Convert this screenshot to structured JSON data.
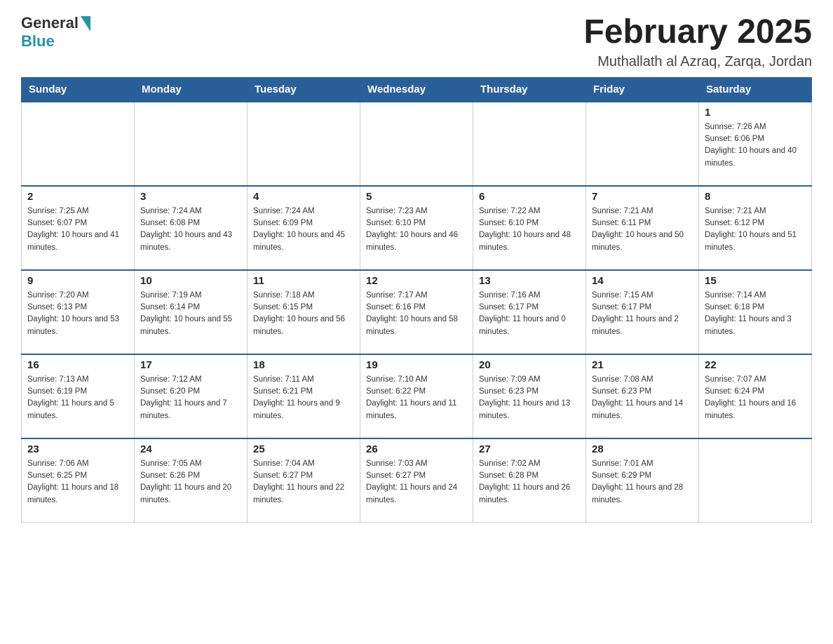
{
  "header": {
    "logo_general": "General",
    "logo_blue": "Blue",
    "month_title": "February 2025",
    "location": "Muthallath al Azraq, Zarqa, Jordan"
  },
  "weekdays": [
    "Sunday",
    "Monday",
    "Tuesday",
    "Wednesday",
    "Thursday",
    "Friday",
    "Saturday"
  ],
  "weeks": [
    [
      {
        "day": "",
        "sunrise": "",
        "sunset": "",
        "daylight": ""
      },
      {
        "day": "",
        "sunrise": "",
        "sunset": "",
        "daylight": ""
      },
      {
        "day": "",
        "sunrise": "",
        "sunset": "",
        "daylight": ""
      },
      {
        "day": "",
        "sunrise": "",
        "sunset": "",
        "daylight": ""
      },
      {
        "day": "",
        "sunrise": "",
        "sunset": "",
        "daylight": ""
      },
      {
        "day": "",
        "sunrise": "",
        "sunset": "",
        "daylight": ""
      },
      {
        "day": "1",
        "sunrise": "Sunrise: 7:26 AM",
        "sunset": "Sunset: 6:06 PM",
        "daylight": "Daylight: 10 hours and 40 minutes."
      }
    ],
    [
      {
        "day": "2",
        "sunrise": "Sunrise: 7:25 AM",
        "sunset": "Sunset: 6:07 PM",
        "daylight": "Daylight: 10 hours and 41 minutes."
      },
      {
        "day": "3",
        "sunrise": "Sunrise: 7:24 AM",
        "sunset": "Sunset: 6:08 PM",
        "daylight": "Daylight: 10 hours and 43 minutes."
      },
      {
        "day": "4",
        "sunrise": "Sunrise: 7:24 AM",
        "sunset": "Sunset: 6:09 PM",
        "daylight": "Daylight: 10 hours and 45 minutes."
      },
      {
        "day": "5",
        "sunrise": "Sunrise: 7:23 AM",
        "sunset": "Sunset: 6:10 PM",
        "daylight": "Daylight: 10 hours and 46 minutes."
      },
      {
        "day": "6",
        "sunrise": "Sunrise: 7:22 AM",
        "sunset": "Sunset: 6:10 PM",
        "daylight": "Daylight: 10 hours and 48 minutes."
      },
      {
        "day": "7",
        "sunrise": "Sunrise: 7:21 AM",
        "sunset": "Sunset: 6:11 PM",
        "daylight": "Daylight: 10 hours and 50 minutes."
      },
      {
        "day": "8",
        "sunrise": "Sunrise: 7:21 AM",
        "sunset": "Sunset: 6:12 PM",
        "daylight": "Daylight: 10 hours and 51 minutes."
      }
    ],
    [
      {
        "day": "9",
        "sunrise": "Sunrise: 7:20 AM",
        "sunset": "Sunset: 6:13 PM",
        "daylight": "Daylight: 10 hours and 53 minutes."
      },
      {
        "day": "10",
        "sunrise": "Sunrise: 7:19 AM",
        "sunset": "Sunset: 6:14 PM",
        "daylight": "Daylight: 10 hours and 55 minutes."
      },
      {
        "day": "11",
        "sunrise": "Sunrise: 7:18 AM",
        "sunset": "Sunset: 6:15 PM",
        "daylight": "Daylight: 10 hours and 56 minutes."
      },
      {
        "day": "12",
        "sunrise": "Sunrise: 7:17 AM",
        "sunset": "Sunset: 6:16 PM",
        "daylight": "Daylight: 10 hours and 58 minutes."
      },
      {
        "day": "13",
        "sunrise": "Sunrise: 7:16 AM",
        "sunset": "Sunset: 6:17 PM",
        "daylight": "Daylight: 11 hours and 0 minutes."
      },
      {
        "day": "14",
        "sunrise": "Sunrise: 7:15 AM",
        "sunset": "Sunset: 6:17 PM",
        "daylight": "Daylight: 11 hours and 2 minutes."
      },
      {
        "day": "15",
        "sunrise": "Sunrise: 7:14 AM",
        "sunset": "Sunset: 6:18 PM",
        "daylight": "Daylight: 11 hours and 3 minutes."
      }
    ],
    [
      {
        "day": "16",
        "sunrise": "Sunrise: 7:13 AM",
        "sunset": "Sunset: 6:19 PM",
        "daylight": "Daylight: 11 hours and 5 minutes."
      },
      {
        "day": "17",
        "sunrise": "Sunrise: 7:12 AM",
        "sunset": "Sunset: 6:20 PM",
        "daylight": "Daylight: 11 hours and 7 minutes."
      },
      {
        "day": "18",
        "sunrise": "Sunrise: 7:11 AM",
        "sunset": "Sunset: 6:21 PM",
        "daylight": "Daylight: 11 hours and 9 minutes."
      },
      {
        "day": "19",
        "sunrise": "Sunrise: 7:10 AM",
        "sunset": "Sunset: 6:22 PM",
        "daylight": "Daylight: 11 hours and 11 minutes."
      },
      {
        "day": "20",
        "sunrise": "Sunrise: 7:09 AM",
        "sunset": "Sunset: 6:23 PM",
        "daylight": "Daylight: 11 hours and 13 minutes."
      },
      {
        "day": "21",
        "sunrise": "Sunrise: 7:08 AM",
        "sunset": "Sunset: 6:23 PM",
        "daylight": "Daylight: 11 hours and 14 minutes."
      },
      {
        "day": "22",
        "sunrise": "Sunrise: 7:07 AM",
        "sunset": "Sunset: 6:24 PM",
        "daylight": "Daylight: 11 hours and 16 minutes."
      }
    ],
    [
      {
        "day": "23",
        "sunrise": "Sunrise: 7:06 AM",
        "sunset": "Sunset: 6:25 PM",
        "daylight": "Daylight: 11 hours and 18 minutes."
      },
      {
        "day": "24",
        "sunrise": "Sunrise: 7:05 AM",
        "sunset": "Sunset: 6:26 PM",
        "daylight": "Daylight: 11 hours and 20 minutes."
      },
      {
        "day": "25",
        "sunrise": "Sunrise: 7:04 AM",
        "sunset": "Sunset: 6:27 PM",
        "daylight": "Daylight: 11 hours and 22 minutes."
      },
      {
        "day": "26",
        "sunrise": "Sunrise: 7:03 AM",
        "sunset": "Sunset: 6:27 PM",
        "daylight": "Daylight: 11 hours and 24 minutes."
      },
      {
        "day": "27",
        "sunrise": "Sunrise: 7:02 AM",
        "sunset": "Sunset: 6:28 PM",
        "daylight": "Daylight: 11 hours and 26 minutes."
      },
      {
        "day": "28",
        "sunrise": "Sunrise: 7:01 AM",
        "sunset": "Sunset: 6:29 PM",
        "daylight": "Daylight: 11 hours and 28 minutes."
      },
      {
        "day": "",
        "sunrise": "",
        "sunset": "",
        "daylight": ""
      }
    ]
  ]
}
